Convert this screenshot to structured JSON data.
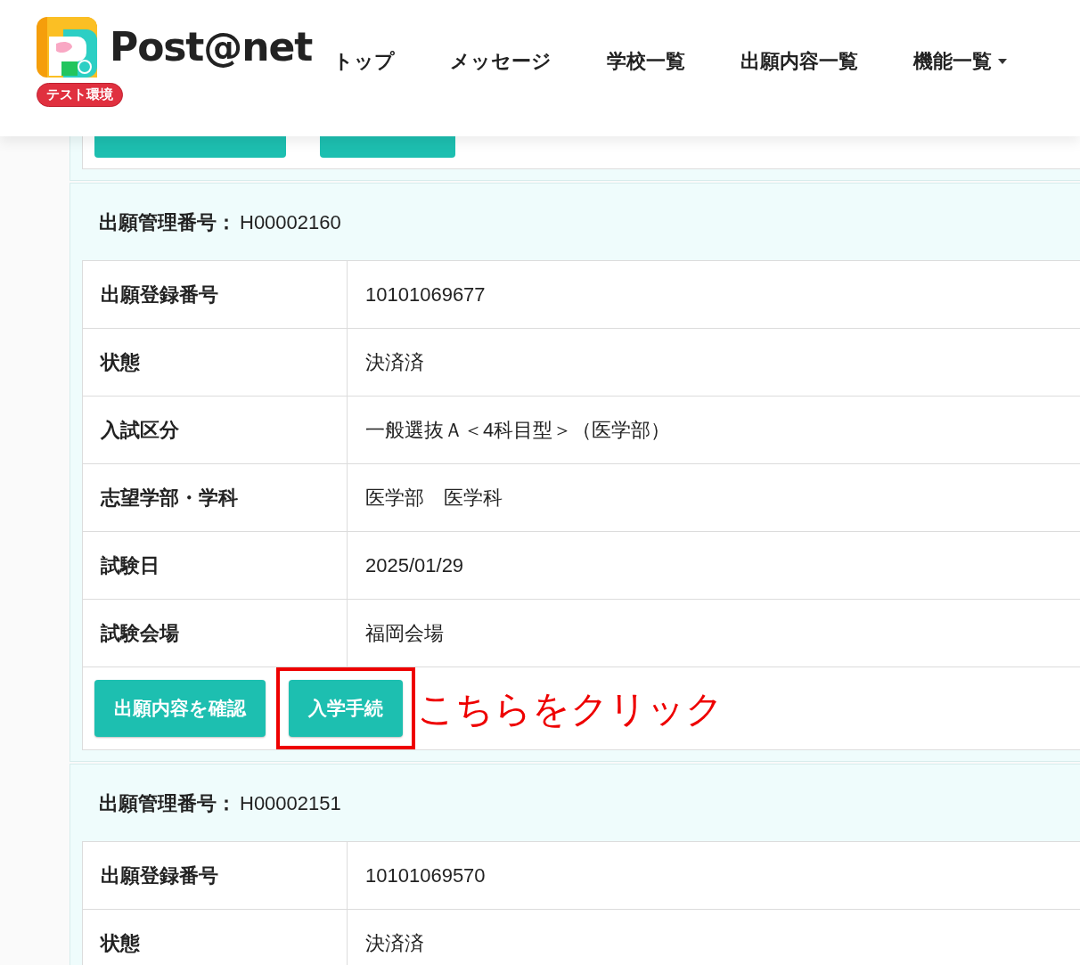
{
  "header": {
    "logo_text": "Post@net",
    "env_badge": "テスト環境",
    "nav": [
      {
        "label": "トップ",
        "dropdown": false
      },
      {
        "label": "メッセージ",
        "dropdown": false
      },
      {
        "label": "学校一覧",
        "dropdown": false
      },
      {
        "label": "出願内容一覧",
        "dropdown": false
      },
      {
        "label": "機能一覧",
        "dropdown": true
      }
    ]
  },
  "cards": [
    {
      "title_label": "出願管理番号：",
      "title_value": "H00002160",
      "rows": [
        {
          "label": "出願登録番号",
          "value": "10101069677"
        },
        {
          "label": "状態",
          "value": "決済済"
        },
        {
          "label": "入試区分",
          "value": "一般選抜Ａ＜4科目型＞（医学部）"
        },
        {
          "label": "志望学部・学科",
          "value": "医学部　医学科"
        },
        {
          "label": "試験日",
          "value": "2025/01/29"
        },
        {
          "label": "試験会場",
          "value": "福岡会場"
        }
      ],
      "buttons": [
        {
          "label": "出願内容を確認",
          "highlighted": false
        },
        {
          "label": "入学手続",
          "highlighted": true
        }
      ],
      "callout": "こちらをクリック"
    },
    {
      "title_label": "出願管理番号：",
      "title_value": "H00002151",
      "rows": [
        {
          "label": "出願登録番号",
          "value": "10101069570"
        },
        {
          "label": "状態",
          "value": "決済済"
        }
      ]
    }
  ]
}
